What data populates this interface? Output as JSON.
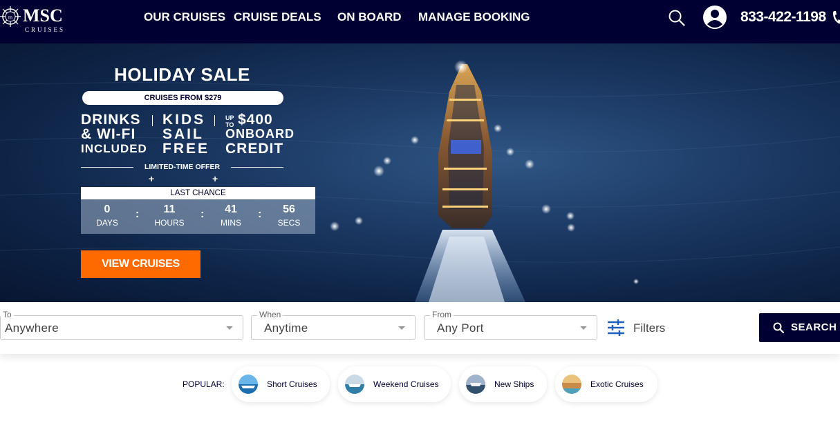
{
  "header": {
    "logo_text": "MSC",
    "logo_subtext": "CRUISES",
    "nav": [
      "OUR CRUISES",
      "CRUISE DEALS",
      "ON BOARD",
      "MANAGE BOOKING"
    ],
    "phone": "833-422-1198",
    "icons": [
      "search-icon",
      "user-icon",
      "phone-icon"
    ]
  },
  "hero": {
    "title": "HOLIDAY SALE",
    "pill": "CRUISES FROM $279",
    "offer1": [
      "DRINKS",
      "& WI-FI",
      "INCLUDED"
    ],
    "offer2": [
      "KIDS",
      "SAIL",
      "FREE"
    ],
    "offer3_upto": [
      "UP",
      "TO"
    ],
    "offer3": [
      "$400",
      "ONBOARD",
      "CREDIT"
    ],
    "limited": "LIMITED-TIME OFFER",
    "countdown": {
      "heading": "LAST CHANCE",
      "units": [
        {
          "value": "0",
          "label": "DAYS"
        },
        {
          "value": "11",
          "label": "HOURS"
        },
        {
          "value": "41",
          "label": "MINS"
        },
        {
          "value": "56",
          "label": "SECS"
        }
      ]
    },
    "cta": "VIEW CRUISES"
  },
  "search": {
    "to": {
      "label": "To",
      "value": "Anywhere"
    },
    "when": {
      "label": "When",
      "value": "Anytime"
    },
    "from": {
      "label": "From",
      "value": "Any Port"
    },
    "filters": "Filters",
    "button": "SEARCH"
  },
  "popular": {
    "label": "POPULAR:",
    "items": [
      "Short Cruises",
      "Weekend Cruises",
      "New Ships",
      "Exotic Cruises"
    ]
  },
  "colors": {
    "navy": "#000033",
    "orange": "#ff6a00",
    "filter_blue": "#1f5fbf"
  }
}
